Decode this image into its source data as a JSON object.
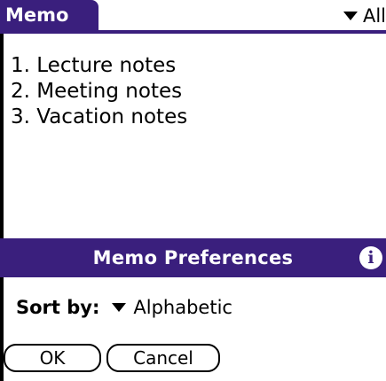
{
  "app": {
    "title": "Memo",
    "category": "All"
  },
  "memos": [
    "1. Lecture notes",
    "2. Meeting notes",
    "3. Vacation notes"
  ],
  "dialog": {
    "title": "Memo Preferences",
    "info_icon": "info-icon",
    "sort_label": "Sort by:",
    "sort_value": "Alphabetic",
    "ok_label": "OK",
    "cancel_label": "Cancel"
  },
  "colors": {
    "accent": "#3a1f7d",
    "background": "#ffffff",
    "text": "#000000"
  }
}
